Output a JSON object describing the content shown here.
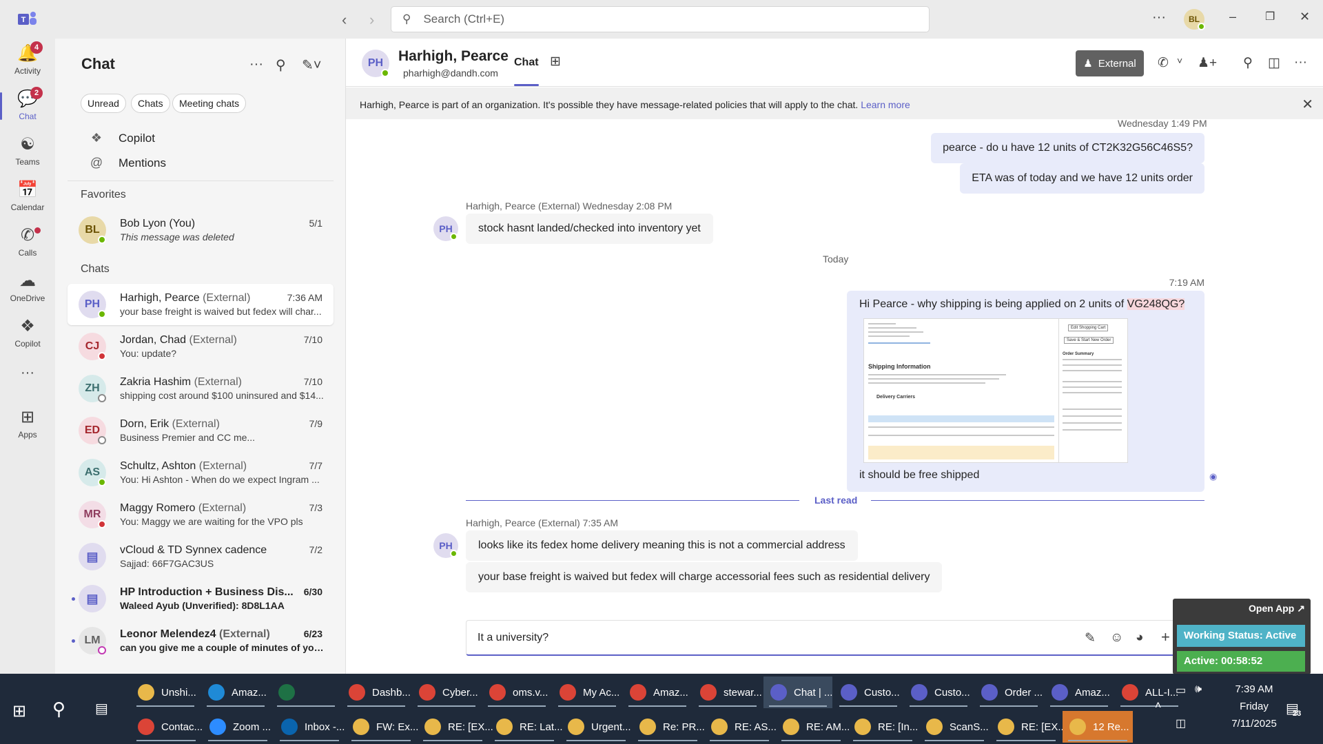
{
  "titlebar": {
    "search_placeholder": "Search (Ctrl+E)",
    "user_initials": "BL"
  },
  "rail": {
    "items": [
      {
        "label": "Activity",
        "icon": "bell-icon",
        "badge": "4"
      },
      {
        "label": "Chat",
        "icon": "chat-icon",
        "badge": "2"
      },
      {
        "label": "Teams",
        "icon": "teams-icon"
      },
      {
        "label": "Calendar",
        "icon": "calendar-icon"
      },
      {
        "label": "Calls",
        "icon": "phone-icon"
      },
      {
        "label": "OneDrive",
        "icon": "cloud-icon"
      },
      {
        "label": "Copilot",
        "icon": "copilot-icon"
      },
      {
        "label": "Apps",
        "icon": "apps-icon"
      }
    ]
  },
  "chatlist": {
    "title": "Chat",
    "filters": [
      "Unread",
      "Chats",
      "Meeting chats"
    ],
    "nav": [
      "Copilot",
      "Mentions"
    ],
    "favorites_heading": "Favorites",
    "chats_heading": "Chats",
    "favorites": [
      {
        "initials": "BL",
        "name": "Bob Lyon (You)",
        "preview": "This message was deleted",
        "date": "5/1"
      }
    ],
    "chats": [
      {
        "initials": "PH",
        "name": "Harhigh, Pearce",
        "ext": "(External)",
        "preview": "your base freight is waived but fedex will char...",
        "date": "7:36 AM"
      },
      {
        "initials": "CJ",
        "name": "Jordan, Chad",
        "ext": "(External)",
        "preview": "You: update?",
        "date": "7/10"
      },
      {
        "initials": "ZH",
        "name": "Zakria Hashim",
        "ext": "(External)",
        "preview": "shipping cost around $100 uninsured and $14...",
        "date": "7/10"
      },
      {
        "initials": "ED",
        "name": "Dorn, Erik",
        "ext": "(External)",
        "preview": "Business Premier and CC me...",
        "date": "7/9"
      },
      {
        "initials": "AS",
        "name": "Schultz, Ashton",
        "ext": "(External)",
        "preview": "You: Hi Ashton -  When do we expect Ingram ...",
        "date": "7/7"
      },
      {
        "initials": "MR",
        "name": "Maggy Romero",
        "ext": "(External)",
        "preview": "You: Maggy we are waiting for the VPO pls",
        "date": "7/3"
      },
      {
        "initials": "",
        "name": "vCloud & TD Synnex cadence",
        "ext": "",
        "preview": "Sajjad: 66F7GAC3US",
        "date": "7/2"
      },
      {
        "initials": "",
        "name": "HP Introduction + Business Dis...",
        "ext": "",
        "preview": "Waleed Ayub (Unverified): 8D8L1AA",
        "date": "6/30"
      },
      {
        "initials": "LM",
        "name": "Leonor Melendez4",
        "ext": "(External)",
        "preview": "can you give me a couple of minutes of your...",
        "date": "6/23"
      }
    ]
  },
  "conversation": {
    "initials": "PH",
    "name": "Harhigh, Pearce",
    "email": "pharhigh@dandh.com",
    "tab": "Chat",
    "external_label": "External",
    "banner_text": "Harhigh, Pearce is part of an organization. It's possible they have message-related policies that will apply to the chat.",
    "banner_link": "Learn more",
    "messages": {
      "top_timestamp": "Wednesday 1:49 PM",
      "out1": "pearce -  do u have 12 units of CT2K32G56C46S5?",
      "out2": "ETA was of today and we have 12 units order",
      "in1_meta": "Harhigh, Pearce (External)   Wednesday 2:08 PM",
      "in1": "stock hasnt landed/checked into inventory yet",
      "today_label": "Today",
      "out3_time": "7:19 AM",
      "out3_prefix": "Hi Pearce -  why shipping is being applied on 2 units of ",
      "out3_highlight": "VG248QG?",
      "out3_caption": "it should be free shipped",
      "last_read": "Last read",
      "in2_meta": "Harhigh, Pearce (External)   7:35 AM",
      "in2": "looks like its fedex home delivery meaning this is not a commercial address",
      "in3": "your base freight is waived but fedex will charge accessorial fees such as residential delivery"
    },
    "embedded_screenshot": {
      "heading": "Shipping Information",
      "carriers_label": "Delivery Carriers",
      "edit_cart": "Edit Shopping Cart",
      "save_order": "Save & Start New Order",
      "order_summary": "Order Summary"
    },
    "compose_value": "It a university?"
  },
  "overlay": {
    "open_app": "Open App",
    "working_status": "Working Status: Active",
    "active_time": "Active: 00:58:52"
  },
  "taskbar": {
    "row1": [
      {
        "label": "Unshi...",
        "icon": "folder-icon",
        "color": "#e8b84a"
      },
      {
        "label": "Amaz...",
        "icon": "edge-icon",
        "color": "#1f8ad6"
      },
      {
        "label": "",
        "icon": "excel-icon",
        "color": "#1e7145"
      },
      {
        "label": "Dashb...",
        "icon": "chrome-icon",
        "color": "#db4437"
      },
      {
        "label": "Cyber...",
        "icon": "chrome-icon",
        "color": "#db4437"
      },
      {
        "label": "oms.v...",
        "icon": "chrome-icon",
        "color": "#db4437"
      },
      {
        "label": "My Ac...",
        "icon": "chrome-icon",
        "color": "#db4437"
      },
      {
        "label": "Amaz...",
        "icon": "chrome-icon",
        "color": "#db4437"
      },
      {
        "label": "stewar...",
        "icon": "chrome-icon",
        "color": "#db4437"
      },
      {
        "label": "Chat | ...",
        "icon": "teams-icon",
        "color": "#5b5fc7"
      },
      {
        "label": "Custo...",
        "icon": "teams-icon",
        "color": "#5b5fc7"
      },
      {
        "label": "Custo...",
        "icon": "teams-icon",
        "color": "#5b5fc7"
      },
      {
        "label": "Order ...",
        "icon": "teams-icon",
        "color": "#5b5fc7"
      },
      {
        "label": "Amaz...",
        "icon": "teams-icon",
        "color": "#5b5fc7"
      },
      {
        "label": "ALL-I...",
        "icon": "chrome-icon",
        "color": "#db4437"
      }
    ],
    "row2": [
      {
        "label": "Contac...",
        "icon": "chrome-icon",
        "color": "#db4437"
      },
      {
        "label": "Zoom ...",
        "icon": "zoom-icon",
        "color": "#2d8cff"
      },
      {
        "label": "Inbox -...",
        "icon": "outlook-icon",
        "color": "#0a64ad"
      },
      {
        "label": "FW: Ex...",
        "icon": "mail-icon",
        "color": "#e8b84a"
      },
      {
        "label": "RE: [EX...",
        "icon": "mail-icon",
        "color": "#e8b84a"
      },
      {
        "label": "RE: Lat...",
        "icon": "mail-icon",
        "color": "#e8b84a"
      },
      {
        "label": "Urgent...",
        "icon": "mail-icon",
        "color": "#e8b84a"
      },
      {
        "label": "Re: PR...",
        "icon": "mail-icon",
        "color": "#e8b84a"
      },
      {
        "label": "RE: AS...",
        "icon": "mail-icon",
        "color": "#e8b84a"
      },
      {
        "label": "RE: AM...",
        "icon": "mail-icon",
        "color": "#e8b84a"
      },
      {
        "label": "RE: [In...",
        "icon": "mail-icon",
        "color": "#e8b84a"
      },
      {
        "label": "ScanS...",
        "icon": "mail-icon",
        "color": "#e8b84a"
      },
      {
        "label": "RE: [EX...",
        "icon": "mail-icon",
        "color": "#e8b84a"
      },
      {
        "label": "12 Re...",
        "icon": "bell-icon",
        "color": "#e8b84a"
      }
    ],
    "time": "7:39 AM",
    "day": "Friday",
    "date": "7/11/2025",
    "notification_count": "23"
  }
}
